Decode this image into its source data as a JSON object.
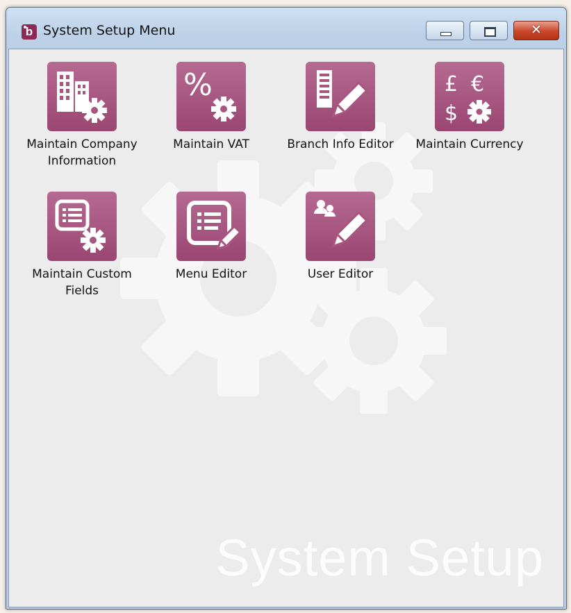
{
  "window": {
    "title": "System Setup Menu",
    "app_icon_letter": "b",
    "minimize_glyph": "",
    "maximize_glyph": "",
    "close_glyph": "✕"
  },
  "watermark": "System Setup",
  "tiles": [
    {
      "label": "Maintain Company\nInformation",
      "icon": "buildings-gear-icon"
    },
    {
      "label": "Maintain VAT",
      "icon": "percent-gear-icon"
    },
    {
      "label": "Branch Info Editor",
      "icon": "building-pencil-icon"
    },
    {
      "label": "Maintain Currency",
      "icon": "currency-gear-icon"
    },
    {
      "label": "Maintain Custom\nFields",
      "icon": "form-gear-icon"
    },
    {
      "label": "Menu Editor",
      "icon": "form-pencil-icon"
    },
    {
      "label": "User Editor",
      "icon": "users-pencil-icon"
    }
  ],
  "colors": {
    "tile_bg": "#a8567f",
    "title_bar": "#bcd1e8",
    "client_bg": "#ececec"
  }
}
